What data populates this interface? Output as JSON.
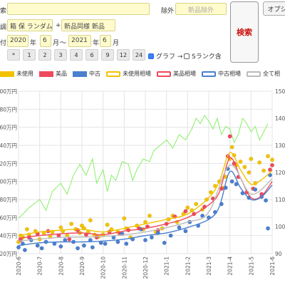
{
  "form": {
    "keyword_label": "索",
    "exclude_label": "除外",
    "exclude_value": "新品除外",
    "search_button": "検索",
    "option_button": "オプシ",
    "condition_label": "調",
    "brand_value": "箱 保 ランダム",
    "plus": "+",
    "type_value": "新品同様 新品",
    "date_label": "付",
    "from_year": "2020",
    "from_year_unit": "年",
    "from_month": "6",
    "from_month_unit": "月",
    "tilde": "～",
    "to_year": "2021",
    "to_year_unit": "年",
    "to_month": "6",
    "to_month_unit": "月",
    "quick_chips": [
      "*",
      "1",
      "2",
      "3",
      "4",
      "6",
      "9",
      "12",
      "24"
    ],
    "graph_label": "グラフ →",
    "graph_checked": true,
    "srank_label": "Sランク含",
    "srank_checked": false
  },
  "legend": {
    "items": [
      {
        "label": "未使用",
        "kind": "box",
        "color": "#f2c200"
      },
      {
        "label": "美品",
        "kind": "box",
        "color": "#ef4a5d"
      },
      {
        "label": "中古",
        "kind": "box",
        "color": "#4a7fd0"
      },
      {
        "label": "未使用相場",
        "kind": "line",
        "color": "#f2c200"
      },
      {
        "label": "美品相場",
        "kind": "line",
        "color": "#ef4a5d"
      },
      {
        "label": "中古相場",
        "kind": "line",
        "color": "#4a7fd0"
      },
      {
        "label": "全て相",
        "kind": "line",
        "color": "#bbbbbb"
      }
    ]
  },
  "chart_data": {
    "type": "scatter",
    "x_type": "date",
    "x_ticks": [
      "2020-6",
      "2020-7",
      "2020-8",
      "2020-9",
      "2020-10",
      "2020-11",
      "2020-12",
      "2021-1",
      "2021-2",
      "2021-3",
      "2021-4",
      "2021-5",
      "2021-6"
    ],
    "y_left_ticks": [
      "00万円",
      "80万円",
      "60万円",
      "40万円",
      "20万円",
      "00万円",
      "80万円",
      "60万円",
      "40万円",
      "20万円"
    ],
    "y_left_range": [
      20,
      200
    ],
    "y_right_ticks": [
      "150",
      "140",
      "130",
      "120",
      "110",
      "100",
      "90"
    ],
    "y_right_range": [
      90,
      150
    ],
    "grid": true,
    "series": [
      {
        "name": "未使用",
        "color": "#f2c200",
        "kind": "points",
        "points": [
          [
            0.0,
            33
          ],
          [
            0.1,
            40
          ],
          [
            0.2,
            38
          ],
          [
            0.4,
            47
          ],
          [
            0.5,
            41
          ],
          [
            0.8,
            45
          ],
          [
            1.0,
            36
          ],
          [
            1.2,
            43
          ],
          [
            1.5,
            39
          ],
          [
            1.6,
            44
          ],
          [
            2.0,
            49
          ],
          [
            2.1,
            45
          ],
          [
            2.3,
            40
          ],
          [
            2.5,
            53
          ],
          [
            2.7,
            47
          ],
          [
            2.9,
            43
          ],
          [
            3.0,
            51
          ],
          [
            3.1,
            48
          ],
          [
            3.3,
            44
          ],
          [
            3.4,
            57
          ],
          [
            3.6,
            41
          ],
          [
            3.8,
            39
          ],
          [
            4.0,
            41
          ],
          [
            4.2,
            52
          ],
          [
            4.4,
            47
          ],
          [
            4.7,
            44
          ],
          [
            5.0,
            59
          ],
          [
            5.1,
            48
          ],
          [
            5.3,
            38
          ],
          [
            5.6,
            51
          ],
          [
            5.9,
            47
          ],
          [
            6.0,
            55
          ],
          [
            6.2,
            62
          ],
          [
            6.5,
            44
          ],
          [
            6.8,
            48
          ],
          [
            7.1,
            58
          ],
          [
            7.3,
            62
          ],
          [
            7.5,
            55
          ],
          [
            7.8,
            64
          ],
          [
            8.0,
            71
          ],
          [
            8.2,
            68
          ],
          [
            8.4,
            75
          ],
          [
            8.7,
            69
          ],
          [
            8.9,
            80
          ],
          [
            9.1,
            88
          ],
          [
            9.3,
            95
          ],
          [
            9.5,
            100
          ],
          [
            9.7,
            93
          ],
          [
            9.8,
            105
          ],
          [
            10.0,
            125
          ],
          [
            10.1,
            138
          ],
          [
            10.2,
            129
          ],
          [
            10.3,
            118
          ],
          [
            10.5,
            122
          ],
          [
            10.7,
            116
          ],
          [
            10.9,
            110
          ],
          [
            11.0,
            125
          ],
          [
            11.2,
            98
          ],
          [
            11.4,
            121
          ],
          [
            11.6,
            112
          ],
          [
            11.8,
            128
          ],
          [
            12.0,
            124
          ]
        ]
      },
      {
        "name": "美品",
        "color": "#ef4a5d",
        "kind": "points",
        "points": [
          [
            0.1,
            35
          ],
          [
            0.5,
            38
          ],
          [
            0.9,
            42
          ],
          [
            1.4,
            45
          ],
          [
            1.9,
            40
          ],
          [
            2.4,
            36
          ],
          [
            2.8,
            46
          ],
          [
            3.2,
            41
          ],
          [
            3.7,
            38
          ],
          [
            4.3,
            44
          ],
          [
            4.8,
            42
          ],
          [
            5.2,
            46
          ],
          [
            5.7,
            48
          ],
          [
            6.1,
            50
          ],
          [
            6.6,
            46
          ],
          [
            7.0,
            53
          ],
          [
            7.4,
            61
          ],
          [
            7.9,
            67
          ],
          [
            8.3,
            64
          ],
          [
            8.8,
            72
          ],
          [
            9.2,
            81
          ],
          [
            9.6,
            92
          ],
          [
            9.9,
            128
          ],
          [
            10.0,
            150
          ],
          [
            10.2,
            120
          ],
          [
            10.4,
            105
          ],
          [
            10.8,
            88
          ],
          [
            11.1,
            92
          ],
          [
            11.5,
            86
          ],
          [
            11.9,
            113
          ],
          [
            12.0,
            118
          ]
        ]
      },
      {
        "name": "中古",
        "color": "#4a7fd0",
        "kind": "points",
        "points": [
          [
            0.0,
            27
          ],
          [
            0.2,
            31
          ],
          [
            0.3,
            24
          ],
          [
            0.6,
            35
          ],
          [
            0.9,
            29
          ],
          [
            1.1,
            26
          ],
          [
            1.3,
            33
          ],
          [
            1.7,
            31
          ],
          [
            2.0,
            28
          ],
          [
            2.2,
            35
          ],
          [
            2.6,
            33
          ],
          [
            2.8,
            26
          ],
          [
            3.1,
            29
          ],
          [
            3.4,
            35
          ],
          [
            3.5,
            27
          ],
          [
            3.9,
            32
          ],
          [
            4.1,
            31
          ],
          [
            4.5,
            38
          ],
          [
            4.7,
            33
          ],
          [
            4.9,
            42
          ],
          [
            5.1,
            31
          ],
          [
            5.4,
            36
          ],
          [
            5.8,
            47
          ],
          [
            6.0,
            35
          ],
          [
            6.3,
            38
          ],
          [
            6.6,
            43
          ],
          [
            6.9,
            32
          ],
          [
            7.2,
            40
          ],
          [
            7.6,
            49
          ],
          [
            7.9,
            45
          ],
          [
            8.1,
            55
          ],
          [
            8.5,
            51
          ],
          [
            8.7,
            62
          ],
          [
            9.0,
            60
          ],
          [
            9.3,
            66
          ],
          [
            9.6,
            75
          ],
          [
            9.8,
            93
          ],
          [
            9.9,
            114
          ],
          [
            10.1,
            100
          ],
          [
            10.3,
            97
          ],
          [
            10.6,
            87
          ],
          [
            10.9,
            82
          ],
          [
            11.2,
            91
          ],
          [
            11.5,
            83
          ],
          [
            11.7,
            79
          ],
          [
            11.9,
            107
          ],
          [
            11.8,
            48
          ]
        ]
      },
      {
        "name": "未使用相場",
        "color": "#f2c200",
        "kind": "line",
        "points": [
          [
            0,
            40
          ],
          [
            1,
            44
          ],
          [
            2,
            46
          ],
          [
            3,
            47
          ],
          [
            4,
            44
          ],
          [
            5,
            48
          ],
          [
            6,
            53
          ],
          [
            7,
            58
          ],
          [
            8,
            64
          ],
          [
            9,
            82
          ],
          [
            9.5,
            100
          ],
          [
            10,
            132
          ],
          [
            10.5,
            113
          ],
          [
            11,
            97
          ],
          [
            11.5,
            102
          ],
          [
            12,
            112
          ]
        ]
      },
      {
        "name": "美品相場",
        "color": "#ef4a5d",
        "kind": "line",
        "points": [
          [
            0,
            37
          ],
          [
            1,
            40
          ],
          [
            2,
            42
          ],
          [
            3,
            43
          ],
          [
            4,
            41
          ],
          [
            5,
            45
          ],
          [
            6,
            48
          ],
          [
            7,
            53
          ],
          [
            8,
            60
          ],
          [
            9,
            74
          ],
          [
            9.5,
            88
          ],
          [
            10,
            126
          ],
          [
            10.5,
            104
          ],
          [
            11,
            82
          ],
          [
            11.5,
            84
          ],
          [
            12,
            100
          ]
        ]
      },
      {
        "name": "中古相場",
        "color": "#4a7fd0",
        "kind": "line",
        "points": [
          [
            0,
            29
          ],
          [
            1,
            32
          ],
          [
            2,
            33
          ],
          [
            3,
            33
          ],
          [
            4,
            34
          ],
          [
            5,
            36
          ],
          [
            6,
            40
          ],
          [
            7,
            43
          ],
          [
            8,
            49
          ],
          [
            9,
            58
          ],
          [
            9.5,
            72
          ],
          [
            10,
            111
          ],
          [
            10.5,
            93
          ],
          [
            11,
            80
          ],
          [
            11.5,
            83
          ],
          [
            12,
            96
          ]
        ]
      },
      {
        "name": "全て相",
        "color": "#bbbbbb",
        "kind": "line",
        "points": [
          [
            0,
            34
          ],
          [
            2,
            38
          ],
          [
            4,
            39
          ],
          [
            6,
            44
          ],
          [
            8,
            55
          ],
          [
            9,
            66
          ],
          [
            10,
            118
          ],
          [
            11,
            86
          ],
          [
            12,
            103
          ]
        ]
      },
      {
        "name": "index",
        "color": "#88ee66",
        "kind": "index-line",
        "points": [
          [
            0,
            103
          ],
          [
            0.5,
            107
          ],
          [
            1,
            110
          ],
          [
            1.3,
            106
          ],
          [
            1.6,
            113
          ],
          [
            2,
            116
          ],
          [
            2.3,
            112
          ],
          [
            2.6,
            119
          ],
          [
            2.9,
            123
          ],
          [
            3.2,
            119
          ],
          [
            3.5,
            125
          ],
          [
            3.7,
            116
          ],
          [
            4,
            121
          ],
          [
            4.2,
            113
          ],
          [
            4.4,
            119
          ],
          [
            4.6,
            117
          ],
          [
            4.9,
            124
          ],
          [
            5.2,
            123
          ],
          [
            5.4,
            117
          ],
          [
            5.6,
            121
          ],
          [
            5.9,
            125
          ],
          [
            6.2,
            124
          ],
          [
            6.4,
            128
          ],
          [
            6.7,
            130
          ],
          [
            7,
            132
          ],
          [
            7.3,
            129
          ],
          [
            7.6,
            134
          ],
          [
            7.9,
            132
          ],
          [
            8.2,
            136
          ],
          [
            8.4,
            140
          ],
          [
            8.6,
            138
          ],
          [
            8.8,
            141
          ],
          [
            9,
            139
          ],
          [
            9.2,
            136
          ],
          [
            9.4,
            140
          ],
          [
            9.6,
            134
          ],
          [
            9.8,
            137
          ],
          [
            10,
            136
          ],
          [
            10.2,
            131
          ],
          [
            10.4,
            134
          ],
          [
            10.6,
            140
          ],
          [
            10.8,
            138
          ],
          [
            11,
            135
          ],
          [
            11.2,
            137
          ],
          [
            11.4,
            132
          ],
          [
            11.6,
            135
          ],
          [
            11.8,
            138
          ]
        ]
      }
    ]
  }
}
